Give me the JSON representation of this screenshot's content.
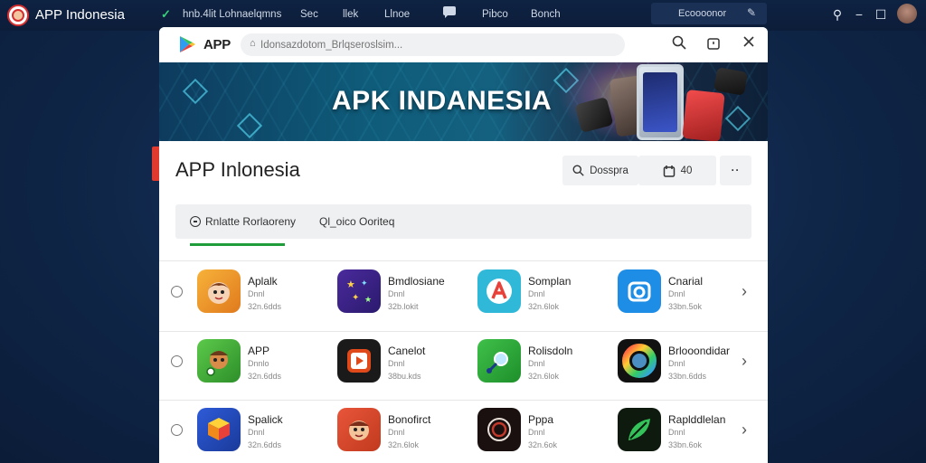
{
  "topbar": {
    "app_title": "APP Indonesia",
    "items": [
      "hnb.4lit Lohnaelqmns",
      "Sec",
      "llek",
      "Llnoe",
      "Pibco",
      "Bonch"
    ],
    "search_label": "Ecoooonor"
  },
  "window": {
    "app_name": "APP",
    "url_placeholder": "Idonsazdotom_Brlqseroslsim...",
    "banner_title": "APK INDANESIA",
    "page_title": "APP Inlonesia",
    "buttons": {
      "search": "Dosspra",
      "cart": "40"
    },
    "tabs": [
      "Rnlatte Rorlaoreny",
      "Ql_oico Ooriteq"
    ]
  },
  "apps": [
    [
      {
        "name": "Aplalk",
        "sub": "Dnnl",
        "size": "32n.6dds"
      },
      {
        "name": "Bmdlosiane",
        "sub": "Dnnl",
        "size": "32b.lokit"
      },
      {
        "name": "Somplan",
        "sub": "Dnnl",
        "size": "32n.6lok"
      },
      {
        "name": "Cnarial",
        "sub": "Dnnl",
        "size": "33bn.5ok"
      }
    ],
    [
      {
        "name": "APP",
        "sub": "Dnnlo",
        "size": "32n.6dds"
      },
      {
        "name": "Canelot",
        "sub": "Dnnl",
        "size": "38bu.kds"
      },
      {
        "name": "Rolisdoln",
        "sub": "Dnnl",
        "size": "32n.6lok"
      },
      {
        "name": "Brlooondidar",
        "sub": "Dnnl",
        "size": "33bn.6dds"
      }
    ],
    [
      {
        "name": "Spalick",
        "sub": "Dnnl",
        "size": "32n.6dds"
      },
      {
        "name": "Bonofirct",
        "sub": "Dnnl",
        "size": "32n.6lok"
      },
      {
        "name": "Pppa",
        "sub": "Dnnl",
        "size": "32n.6ok"
      },
      {
        "name": "Raplddlelan",
        "sub": "Dnnl",
        "size": "33bn.6ok"
      }
    ]
  ],
  "colors": {
    "accent_green": "#1f9d3a",
    "accent_red": "#e0392d"
  }
}
